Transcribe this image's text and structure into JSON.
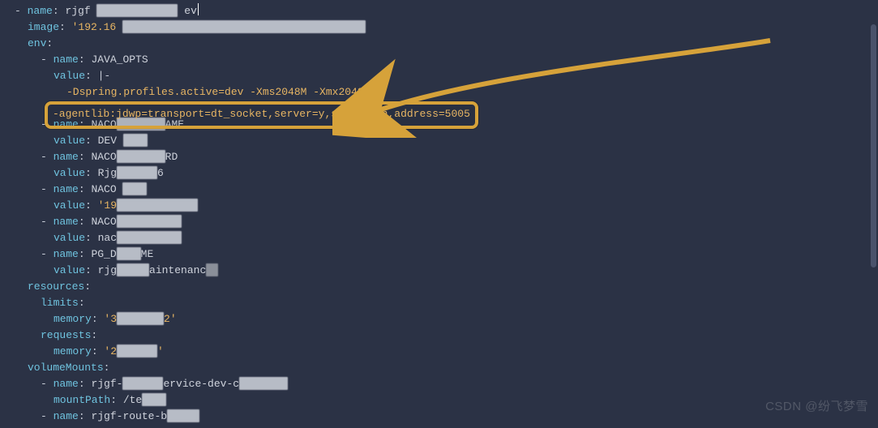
{
  "yaml": {
    "topName_prefix": "rjgf",
    "topName_suffix": "ev",
    "image_prefix": "'192.16",
    "envKey": "env",
    "nameKey": "name",
    "valueKey": "value",
    "imageKey": "image",
    "javaOpts": "JAVA_OPTS",
    "pipe": "|-",
    "springLine": "-Dspring.profiles.active=dev -Xms2048M -Xmx2048M",
    "agentlib": "-agentlib:jdwp=transport=dt_socket,server=y,suspend=n,address=5005",
    "env2_name_prefix": "NACO",
    "env2_name_suffix": "AME",
    "env2_value": "DEV",
    "env3_name_prefix": "NACO",
    "env3_name_suffix": "RD",
    "env3_value_prefix": "Rjg",
    "env3_value_suffix": "6",
    "env4_name": "NACO",
    "env4_value": "'19",
    "env5_name": "NACO",
    "env5_value": "nac",
    "env6_name_prefix": "PG_D",
    "env6_name_suffix": "ME",
    "env6_value_prefix": "rjg",
    "env6_value_suffix": "aintenanc",
    "resourcesKey": "resources",
    "limitsKey": "limits",
    "memoryKey": "memory",
    "limits_memory_prefix": "'3",
    "limits_memory_suffix": "2'",
    "requestsKey": "requests",
    "requests_memory_prefix": "'2",
    "requests_memory_suffix": "'",
    "volumeMountsKey": "volumeMounts",
    "vm1_name_prefix": "rjgf-",
    "vm1_name_mid": "ervice-dev-c",
    "mountPathKey": "mountPath",
    "vm1_mount": "/te",
    "vm2_name": "rjgf-route-b"
  },
  "watermarks": {
    "bottom_right": "CSDN @纷飞梦雪",
    "inline": ""
  }
}
